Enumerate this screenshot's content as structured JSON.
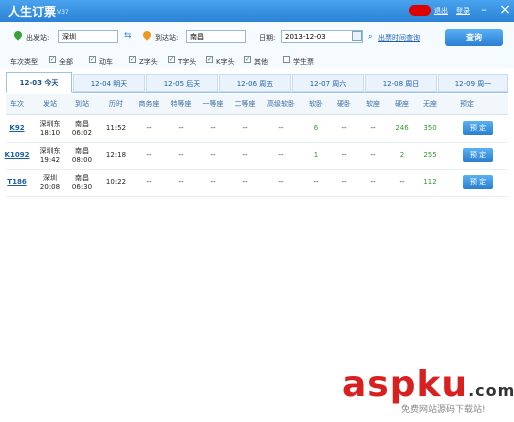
{
  "app": {
    "title": "人生订票",
    "version": "V37"
  },
  "window": {
    "links": [
      "退出",
      "登录"
    ],
    "controls": [
      "–",
      "□",
      "×"
    ]
  },
  "search": {
    "from_label": "出发站:",
    "from_value": "深圳",
    "to_label": "到达站:",
    "to_value": "南昌",
    "date_label": "日期:",
    "date_value": "2013-12-03",
    "timetable_link": "出票时间查询",
    "query_button": "查询"
  },
  "filters": {
    "label": "车次类型",
    "options": [
      {
        "label": "全部",
        "checked": true
      },
      {
        "label": "动车",
        "checked": true
      },
      {
        "label": "Z字头",
        "checked": true
      },
      {
        "label": "T字头",
        "checked": true
      },
      {
        "label": "K字头",
        "checked": true
      },
      {
        "label": "其他",
        "checked": true
      },
      {
        "label": "学生票",
        "checked": false
      }
    ]
  },
  "tabs": [
    {
      "label": "12-03 今天",
      "active": true
    },
    {
      "label": "12-04 明天"
    },
    {
      "label": "12-05 后天"
    },
    {
      "label": "12-06 周五"
    },
    {
      "label": "12-07 周六"
    },
    {
      "label": "12-08 周日"
    },
    {
      "label": "12-09 周一"
    }
  ],
  "table": {
    "headers": [
      "车次",
      "发站",
      "到站",
      "历时",
      "商务座",
      "特等座",
      "一等座",
      "二等座",
      "高级软卧",
      "软卧",
      "硬卧",
      "软座",
      "硬座",
      "无座",
      "预定"
    ],
    "rows": [
      {
        "train": "K92",
        "dep_station": "深圳东",
        "dep_time": "18:10",
        "arr_station": "南昌",
        "arr_time": "06:02",
        "duration": "11:52",
        "business": "--",
        "special": "--",
        "first": "--",
        "second": "--",
        "hsoft": "--",
        "soft_sleeper": "6",
        "hard_sleeper": "--",
        "soft_seat": "--",
        "hard_seat": "246",
        "no_seat": "350",
        "book": "预 定"
      },
      {
        "train": "K1092",
        "dep_station": "深圳东",
        "dep_time": "19:42",
        "arr_station": "南昌",
        "arr_time": "08:00",
        "duration": "12:18",
        "business": "--",
        "special": "--",
        "first": "--",
        "second": "--",
        "hsoft": "--",
        "soft_sleeper": "1",
        "hard_sleeper": "--",
        "soft_seat": "--",
        "hard_seat": "2",
        "no_seat": "255",
        "book": "预 定"
      },
      {
        "train": "T186",
        "dep_station": "深圳",
        "dep_time": "20:08",
        "arr_station": "南昌",
        "arr_time": "06:30",
        "duration": "10:22",
        "business": "--",
        "special": "--",
        "first": "--",
        "second": "--",
        "hsoft": "--",
        "soft_sleeper": "--",
        "hard_sleeper": "--",
        "soft_seat": "--",
        "hard_seat": "--",
        "no_seat": "112",
        "book": "预 定"
      }
    ]
  },
  "watermark": {
    "logo": "aspku",
    "logo_tail": ".com",
    "subtitle": "免费网站源码下载站!"
  },
  "colors": {
    "accent": "#2a82d6",
    "available": "#2f9a2f",
    "link": "#1a5fa6",
    "logo": "#d82020"
  }
}
